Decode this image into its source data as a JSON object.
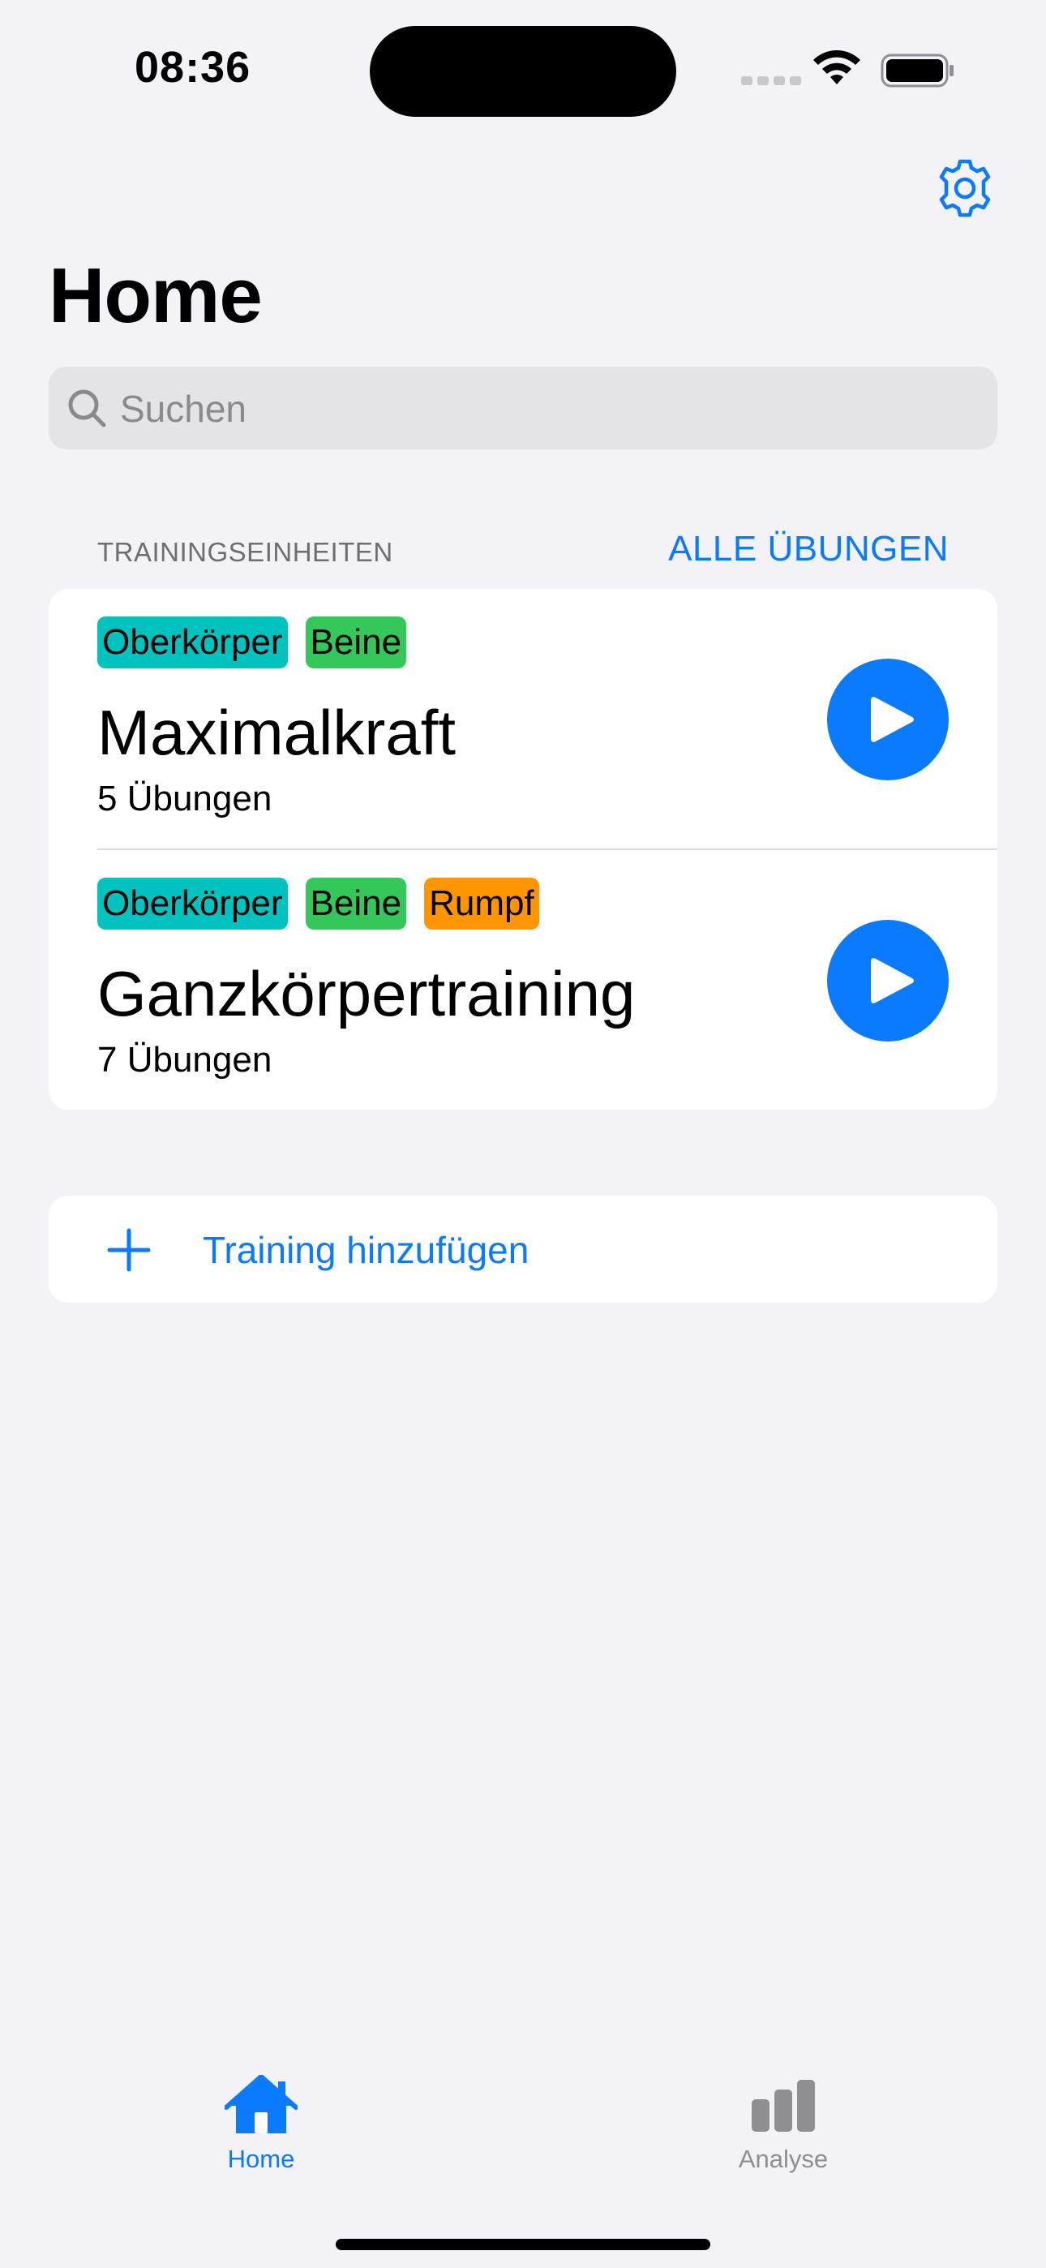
{
  "status_bar": {
    "time": "08:36"
  },
  "header": {
    "title": "Home"
  },
  "search": {
    "placeholder": "Suchen",
    "value": ""
  },
  "section": {
    "title": "TRAININGSEINHEITEN",
    "all_link": "ALLE ÜBUNGEN"
  },
  "workouts": [
    {
      "name": "Maximalkraft",
      "count": "5 Übungen",
      "tags": [
        {
          "label": "Oberkörper",
          "color": "#00c2bf"
        },
        {
          "label": "Beine",
          "color": "#34c759"
        }
      ]
    },
    {
      "name": "Ganzkörpertraining",
      "count": "7 Übungen",
      "tags": [
        {
          "label": "Oberkörper",
          "color": "#00c2bf"
        },
        {
          "label": "Beine",
          "color": "#34c759"
        },
        {
          "label": "Rumpf",
          "color": "#ff9500"
        }
      ]
    }
  ],
  "add_training": {
    "label": "Training hinzufügen"
  },
  "tab_bar": {
    "items": [
      {
        "label": "Home",
        "icon": "house-fill-icon",
        "selected": true
      },
      {
        "label": "Analyse",
        "icon": "chart-bar-icon",
        "selected": false
      }
    ]
  },
  "colors": {
    "accent": "#0a7aff",
    "background": "#f2f2f7"
  }
}
